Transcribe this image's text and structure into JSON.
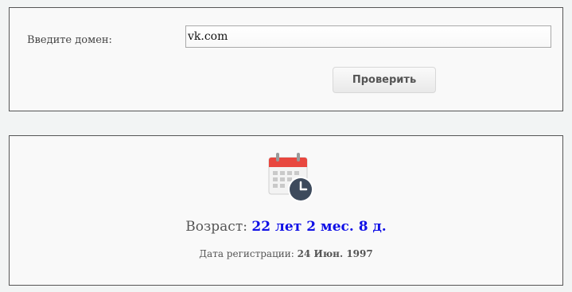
{
  "form": {
    "domain_label": "Введите домен:",
    "domain_value": "vk.com",
    "check_button": "Проверить"
  },
  "result": {
    "icon": "calendar-clock-icon",
    "age_label": "Возраст:",
    "age_value": "22 лет 2 мес. 8 д.",
    "reg_label": "Дата регистрации:",
    "reg_value": "24 Июн. 1997"
  },
  "colors": {
    "age_value": "#1010e6",
    "calendar_header": "#e8473f",
    "clock_face": "#3d4a5c"
  }
}
